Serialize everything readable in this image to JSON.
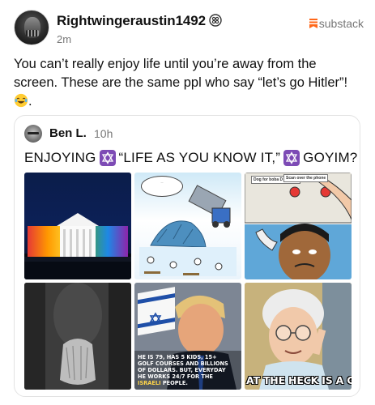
{
  "post": {
    "author": "Rightwingeraustin1492",
    "timestamp": "2m",
    "source_label": "substack",
    "text_part1": "You can’t really enjoy life until you’re away from the screen.   These are the same ppl who say “let’s go Hitler”!",
    "text_part2": "."
  },
  "quoted_post": {
    "author": "Ben L.",
    "timestamp": "10h",
    "text_a": "ENJOYING",
    "text_b": "“LIFE AS YOU KNOW IT,”",
    "text_c": "GOYIM?",
    "images": [
      {
        "name": "image-white-house"
      },
      {
        "name": "image-comic-truck"
      },
      {
        "name": "image-comic-buttons",
        "labels": [
          "Dog for boba D Vagene",
          "Scan over the phone"
        ]
      },
      {
        "name": "image-hands-praying"
      },
      {
        "name": "image-trump-flag",
        "caption_1": "HE IS 79, HAS 5 KIDS, 15+ GOLF COURSES AND BILLIONS OF DOLLARS. BUT, EVERYDAY HE WORKS 24/7 FOR THE",
        "caption_hl": "ISRAELI",
        "caption_2": "PEOPLE."
      },
      {
        "name": "image-old-woman-meme",
        "meme_text": "AT THE HECK IS A GOYI"
      }
    ]
  },
  "colors": {
    "text": "#111111",
    "muted": "#777777",
    "substack_orange": "#ff6719",
    "star_purple": "#7d4bb5",
    "card_border": "#e3e3e3"
  },
  "icons": [
    "badge-icon",
    "substack-icon",
    "laughing-emoji-icon",
    "star-of-david-icon"
  ]
}
